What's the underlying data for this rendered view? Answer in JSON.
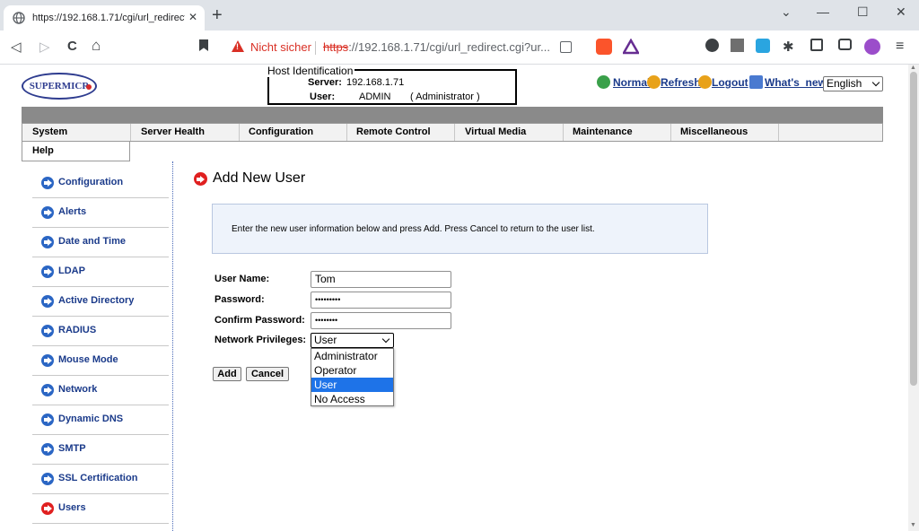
{
  "browser": {
    "tab_title": "https://192.168.1.71/cgi/url_redirect.c",
    "tab_close": "✕",
    "new_tab": "+",
    "minimize": "⌄",
    "restore": "—",
    "maximize": "☐",
    "close": "✕",
    "back": "◁",
    "forward": "▷",
    "reload": "C",
    "home": "⌂",
    "not_secure": "Nicht sicher",
    "url_scheme": "https",
    "url_rest": "://192.168.1.71/cgi/url_redirect.cgi?ur...",
    "menu": "≡"
  },
  "header": {
    "logo_text": "SUPERMICR",
    "host_legend": "Host Identification",
    "server_label": "Server:",
    "server_value": "192.168.1.71",
    "user_label": "User:",
    "user_value": "ADMIN",
    "user_role": "( Administrator )",
    "links": [
      "Normal",
      "Refresh",
      "Logout",
      "What's_new"
    ],
    "language": "English"
  },
  "menu": [
    "System",
    "Server Health",
    "Configuration",
    "Remote Control",
    "Virtual Media",
    "Maintenance",
    "Miscellaneous"
  ],
  "help_tab": "Help",
  "sidebar": {
    "items": [
      {
        "label": "Configuration"
      },
      {
        "label": "Alerts"
      },
      {
        "label": "Date and Time"
      },
      {
        "label": "LDAP"
      },
      {
        "label": "Active Directory"
      },
      {
        "label": "RADIUS"
      },
      {
        "label": "Mouse Mode"
      },
      {
        "label": "Network"
      },
      {
        "label": "Dynamic DNS"
      },
      {
        "label": "SMTP"
      },
      {
        "label": "SSL Certification"
      },
      {
        "label": "Users"
      }
    ],
    "active_index": 11
  },
  "main": {
    "heading": "Add New User",
    "info": "Enter the new user information below and press Add. Press Cancel to return to the user list.",
    "form": {
      "username_label": "User Name:",
      "username_value": "Tom",
      "password_label": "Password:",
      "password_value": "•••••••••",
      "confirm_label": "Confirm Password:",
      "confirm_value": "••••••••",
      "privileges_label": "Network Privileges:",
      "privileges_value": "User",
      "privileges_options": [
        "Administrator",
        "Operator",
        "User",
        "No Access"
      ],
      "add_button": "Add",
      "cancel_button": "Cancel"
    }
  },
  "colors": {
    "link": "#1a3a8a",
    "active_arrow": "#e02020",
    "arrow": "#2b66c4",
    "selected_option": "#1e73e8",
    "warning": "#d93025"
  }
}
